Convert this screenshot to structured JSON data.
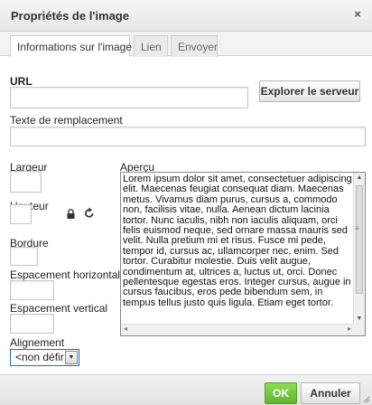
{
  "dialog": {
    "title": "Propriétés de l'image",
    "close_icon": "close-icon",
    "close_glyph": "×"
  },
  "tabs": [
    {
      "label": "Informations sur l'image",
      "active": true
    },
    {
      "label": "Lien",
      "active": false
    },
    {
      "label": "Envoyer",
      "active": false
    }
  ],
  "form": {
    "url_label": "URL",
    "url_value": "",
    "browse_button": "Explorer le serveur",
    "alt_label": "Texte de remplacement",
    "alt_value": "",
    "width_label": "Largeur",
    "width_value": "",
    "height_label": "Hauteur",
    "height_value": "",
    "lock_icon": "lock-icon",
    "reset_icon": "reset-size-icon",
    "border_label": "Bordure",
    "border_value": "",
    "hspace_label": "Espacement horizontal",
    "hspace_value": "",
    "vspace_label": "Espacement vertical",
    "vspace_value": "",
    "align_label": "Alignement",
    "align_selected": "<non défini>",
    "align_selected_visible": "<non défir"
  },
  "preview": {
    "label": "Aperçu",
    "text": "Lorem ipsum dolor sit amet, consectetuer adipiscing elit. Maecenas feugiat consequat diam. Maecenas metus. Vivamus diam purus, cursus a, commodo non, facilisis vitae, nulla. Aenean dictum lacinia tortor. Nunc iaculis, nibh non iaculis aliquam, orci felis euismod neque, sed ornare massa mauris sed velit. Nulla pretium mi et risus. Fusce mi pede, tempor id, cursus ac, ullamcorper nec, enim. Sed tortor. Curabitur molestie. Duis velit augue, condimentum at, ultrices a, luctus ut, orci. Donec pellentesque egestas eros. Integer cursus, augue in cursus faucibus, eros pede bibendum sem, in tempus tellus justo quis ligula. Etiam eget tortor."
  },
  "footer": {
    "ok_label": "OK",
    "cancel_label": "Annuler"
  },
  "colors": {
    "ok_button": "#6cc23a",
    "select_focus_border": "#1a6ac9"
  }
}
